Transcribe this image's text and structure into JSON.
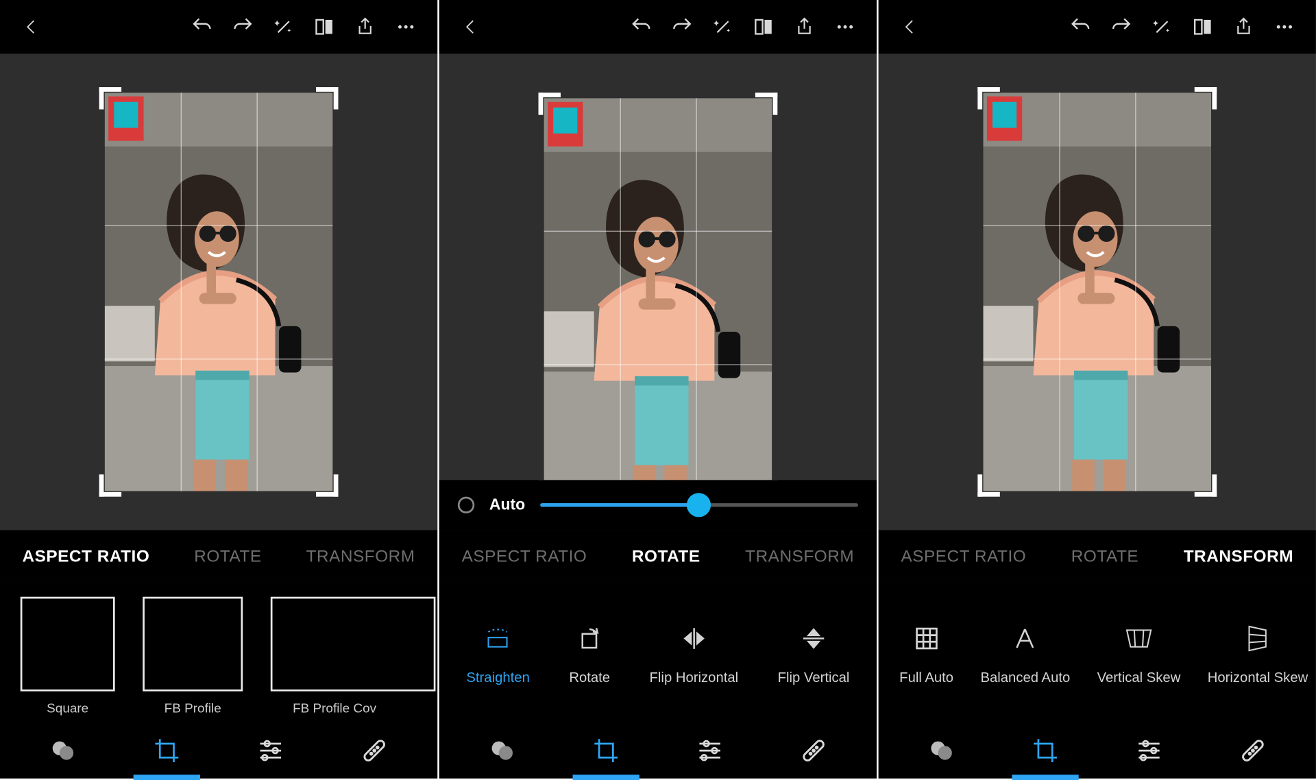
{
  "common": {
    "topbar": {
      "back": "back-icon",
      "undo": "undo-icon",
      "redo": "redo-icon",
      "wand": "magic-wand-icon",
      "compare": "compare-icon",
      "share": "share-icon",
      "more": "more-icon"
    },
    "tabs": {
      "aspect": "ASPECT RATIO",
      "rotate": "ROTATE",
      "transform": "TRANSFORM"
    },
    "bottom": {
      "filters": "filters-icon",
      "crop": "crop-icon",
      "adjust": "adjust-sliders-icon",
      "heal": "heal-bandage-icon"
    }
  },
  "panel1": {
    "tabs_active": "aspect",
    "aspect": [
      {
        "label": "Square"
      },
      {
        "label": "FB Profile"
      },
      {
        "label": "FB Profile Cov"
      }
    ]
  },
  "panel2": {
    "tabs_active": "rotate",
    "autobar": {
      "label": "Auto",
      "value_percent": 50
    },
    "rotate_tools": [
      {
        "label": "Straighten",
        "active": true
      },
      {
        "label": "Rotate"
      },
      {
        "label": "Flip Horizontal"
      },
      {
        "label": "Flip Vertical"
      }
    ]
  },
  "panel3": {
    "tabs_active": "transform",
    "transform_tools": [
      {
        "label": "Full Auto"
      },
      {
        "label": "Balanced Auto"
      },
      {
        "label": "Vertical Skew"
      },
      {
        "label": "Horizontal Skew"
      }
    ]
  }
}
